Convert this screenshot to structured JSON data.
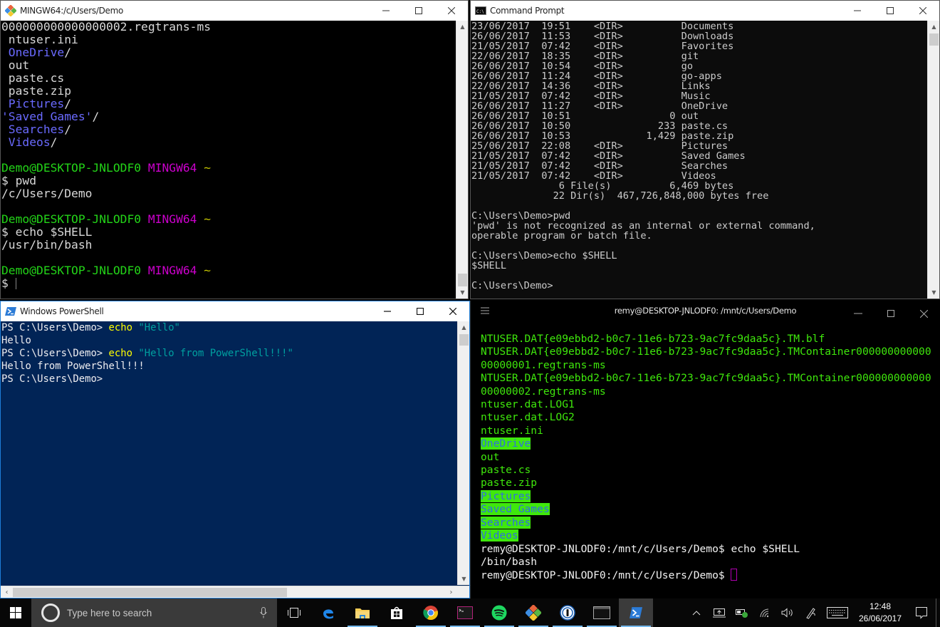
{
  "mingw": {
    "title": "MINGW64:/c/Users/Demo",
    "lines": [
      [
        {
          "t": "000000000000000002.regtrans-ms",
          "c": ""
        }
      ],
      [
        {
          "t": " ntuser.ini",
          "c": ""
        }
      ],
      [
        {
          "t": " OneDrive",
          "c": "c-blue"
        },
        {
          "t": "/",
          "c": ""
        }
      ],
      [
        {
          "t": " out",
          "c": ""
        }
      ],
      [
        {
          "t": " paste.cs",
          "c": ""
        }
      ],
      [
        {
          "t": " paste.zip",
          "c": ""
        }
      ],
      [
        {
          "t": " Pictures",
          "c": "c-blue"
        },
        {
          "t": "/",
          "c": ""
        }
      ],
      [
        {
          "t": "'Saved Games'",
          "c": "c-blue"
        },
        {
          "t": "/",
          "c": ""
        }
      ],
      [
        {
          "t": " Searches",
          "c": "c-blue"
        },
        {
          "t": "/",
          "c": ""
        }
      ],
      [
        {
          "t": " Videos",
          "c": "c-blue"
        },
        {
          "t": "/",
          "c": ""
        }
      ],
      [
        {
          "t": "",
          "c": ""
        }
      ],
      [
        {
          "t": "Demo@DESKTOP-JNLODF0 ",
          "c": "c-green"
        },
        {
          "t": "MINGW64 ",
          "c": "c-mag"
        },
        {
          "t": "~",
          "c": "c-yel"
        }
      ],
      [
        {
          "t": "$ pwd",
          "c": ""
        }
      ],
      [
        {
          "t": "/c/Users/Demo",
          "c": ""
        }
      ],
      [
        {
          "t": "",
          "c": ""
        }
      ],
      [
        {
          "t": "Demo@DESKTOP-JNLODF0 ",
          "c": "c-green"
        },
        {
          "t": "MINGW64 ",
          "c": "c-mag"
        },
        {
          "t": "~",
          "c": "c-yel"
        }
      ],
      [
        {
          "t": "$ echo $SHELL",
          "c": ""
        }
      ],
      [
        {
          "t": "/usr/bin/bash",
          "c": ""
        }
      ],
      [
        {
          "t": "",
          "c": ""
        }
      ],
      [
        {
          "t": "Demo@DESKTOP-JNLODF0 ",
          "c": "c-green"
        },
        {
          "t": "MINGW64 ",
          "c": "c-mag"
        },
        {
          "t": "~",
          "c": "c-yel"
        }
      ],
      [
        {
          "t": "$ ",
          "c": ""
        },
        {
          "t": "|",
          "c": "cursor"
        }
      ]
    ],
    "scroll_position_percent": 100
  },
  "cmd": {
    "title": "Command Prompt",
    "lines": [
      "23/06/2017  19:51    <DIR>          Documents",
      "26/06/2017  11:53    <DIR>          Downloads",
      "21/05/2017  07:42    <DIR>          Favorites",
      "22/06/2017  18:35    <DIR>          git",
      "26/06/2017  10:54    <DIR>          go",
      "26/06/2017  11:24    <DIR>          go-apps",
      "22/06/2017  14:36    <DIR>          Links",
      "21/05/2017  07:42    <DIR>          Music",
      "26/06/2017  11:27    <DIR>          OneDrive",
      "26/06/2017  10:51                 0 out",
      "26/06/2017  10:50               233 paste.cs",
      "26/06/2017  10:53             1,429 paste.zip",
      "25/06/2017  22:08    <DIR>          Pictures",
      "21/05/2017  07:42    <DIR>          Saved Games",
      "21/05/2017  07:42    <DIR>          Searches",
      "21/05/2017  07:42    <DIR>          Videos",
      "               6 File(s)          6,469 bytes",
      "              22 Dir(s)  467,726,848,000 bytes free",
      "",
      "C:\\Users\\Demo>pwd",
      "'pwd' is not recognized as an internal or external command,",
      "operable program or batch file.",
      "",
      "C:\\Users\\Demo>echo $SHELL",
      "$SHELL",
      "",
      "C:\\Users\\Demo>"
    ],
    "scroll_position_percent": 5
  },
  "powershell": {
    "title": "Windows PowerShell",
    "lines": [
      [
        {
          "t": "PS C:\\Users\\Demo> ",
          "c": ""
        },
        {
          "t": "echo",
          "c": "ps-cmd"
        },
        {
          "t": " ",
          "c": ""
        },
        {
          "t": "\"Hello\"",
          "c": "ps-str"
        }
      ],
      [
        {
          "t": "Hello",
          "c": ""
        }
      ],
      [
        {
          "t": "PS C:\\Users\\Demo> ",
          "c": ""
        },
        {
          "t": "echo",
          "c": "ps-cmd"
        },
        {
          "t": " ",
          "c": ""
        },
        {
          "t": "\"Hello from PowerShell!!!\"",
          "c": "ps-str"
        }
      ],
      [
        {
          "t": "Hello from PowerShell!!!",
          "c": ""
        }
      ],
      [
        {
          "t": "PS C:\\Users\\Demo>",
          "c": ""
        }
      ]
    ],
    "vscroll_position_percent": 0,
    "hscroll_position_percent": 0
  },
  "wsl": {
    "title": "remy@DESKTOP-JNLODF0: /mnt/c/Users/Demo",
    "lines": [
      [
        {
          "t": "NTUSER.DAT{e09ebbd2-b0c7-11e6-b723-9ac7fc9daa5c}.TM.blf",
          "c": ""
        }
      ],
      [
        {
          "t": "NTUSER.DAT{e09ebbd2-b0c7-11e6-b723-9ac7fc9daa5c}.TMContainer000000000000",
          "c": ""
        }
      ],
      [
        {
          "t": "00000001.regtrans-ms",
          "c": ""
        }
      ],
      [
        {
          "t": "NTUSER.DAT{e09ebbd2-b0c7-11e6-b723-9ac7fc9daa5c}.TMContainer000000000000",
          "c": ""
        }
      ],
      [
        {
          "t": "00000002.regtrans-ms",
          "c": ""
        }
      ],
      [
        {
          "t": "ntuser.dat.LOG1",
          "c": ""
        }
      ],
      [
        {
          "t": "ntuser.dat.LOG2",
          "c": ""
        }
      ],
      [
        {
          "t": "ntuser.ini",
          "c": ""
        }
      ],
      [
        {
          "t": "OneDrive",
          "c": "hl"
        }
      ],
      [
        {
          "t": "out",
          "c": ""
        }
      ],
      [
        {
          "t": "paste.cs",
          "c": ""
        }
      ],
      [
        {
          "t": "paste.zip",
          "c": ""
        }
      ],
      [
        {
          "t": "Pictures",
          "c": "hl"
        }
      ],
      [
        {
          "t": "Saved Games",
          "c": "hl"
        }
      ],
      [
        {
          "t": "Searches",
          "c": "hl"
        }
      ],
      [
        {
          "t": "Videos",
          "c": "hl"
        }
      ],
      [
        {
          "t": "remy@DESKTOP-JNLODF0:/mnt/c/Users/Demo$ echo $SHELL",
          "c": "w-white"
        }
      ],
      [
        {
          "t": "/bin/bash",
          "c": "w-white"
        }
      ],
      [
        {
          "t": "remy@DESKTOP-JNLODF0:/mnt/c/Users/Demo$ ",
          "c": "w-white"
        },
        {
          "t": "",
          "c": "cursor-box"
        }
      ]
    ]
  },
  "taskbar": {
    "search_placeholder": "Type here to search",
    "apps": [
      {
        "name": "task-view",
        "running": false,
        "active": false
      },
      {
        "name": "edge",
        "running": false,
        "active": false
      },
      {
        "name": "file-explorer",
        "running": true,
        "active": false
      },
      {
        "name": "store",
        "running": false,
        "active": false
      },
      {
        "name": "chrome",
        "running": true,
        "active": false
      },
      {
        "name": "wsl-terminal",
        "running": true,
        "active": false
      },
      {
        "name": "spotify",
        "running": true,
        "active": false
      },
      {
        "name": "git-bash",
        "running": true,
        "active": false
      },
      {
        "name": "1password",
        "running": true,
        "active": false
      },
      {
        "name": "command-prompt",
        "running": true,
        "active": false
      },
      {
        "name": "powershell",
        "running": true,
        "active": true
      }
    ],
    "clock_time": "12:48",
    "clock_date": "26/06/2017"
  },
  "colors": {
    "ps_background": "#012456",
    "mingw_user_green": "#23d418",
    "mingw_magenta": "#cc00cc",
    "wsl_green": "#3fe80c",
    "wsl_dir_blue": "#2f6ee0"
  }
}
